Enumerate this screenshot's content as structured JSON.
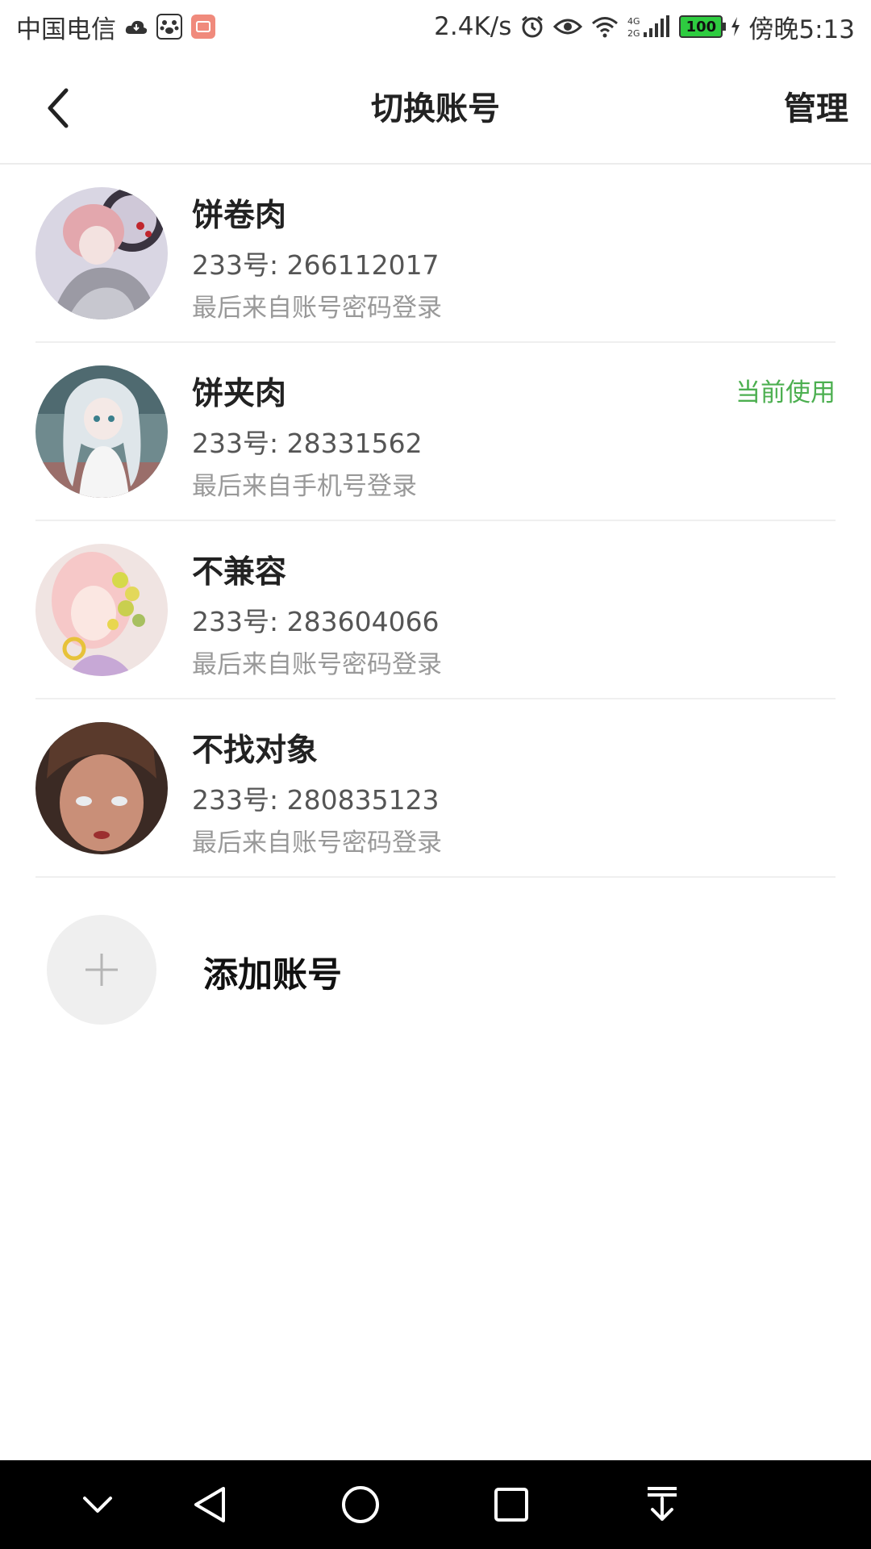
{
  "statusbar": {
    "carrier": "中国电信",
    "speed": "2.4K/s",
    "network": "4G 2G",
    "battery": "100",
    "time": "傍晚5:13"
  },
  "header": {
    "title": "切换账号",
    "manage_label": "管理"
  },
  "accounts": [
    {
      "name": "饼卷肉",
      "uid": "233号: 266112017",
      "login": "最后来自账号密码登录",
      "current": ""
    },
    {
      "name": "饼夹肉",
      "uid": "233号: 28331562",
      "login": "最后来自手机号登录",
      "current": "当前使用"
    },
    {
      "name": "不兼容",
      "uid": "233号: 283604066",
      "login": "最后来自账号密码登录",
      "current": ""
    },
    {
      "name": "不找对象",
      "uid": "233号: 280835123",
      "login": "最后来自账号密码登录",
      "current": ""
    }
  ],
  "add_account": {
    "label": "添加账号"
  },
  "colors": {
    "current_green": "#4caf50",
    "divider": "#efefef",
    "add_circle_bg": "#efefef"
  },
  "icons": {
    "back": "chevron-left-icon",
    "plus": "plus-icon",
    "nav": [
      "chevron-down-icon",
      "back-triangle-icon",
      "home-circle-icon",
      "recents-square-icon",
      "pull-down-icon"
    ]
  }
}
